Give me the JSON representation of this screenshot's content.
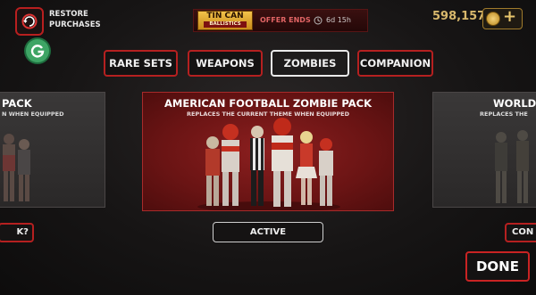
{
  "header": {
    "restore_label": "RESTORE PURCHASES",
    "offer": {
      "logo_line1": "TIN CAN",
      "logo_line2": "BALLISTICS",
      "label": "OFFER ENDS",
      "time": "6d 15h"
    },
    "currency": "598,157"
  },
  "tabs": [
    {
      "label": "RARE SETS",
      "active": false
    },
    {
      "label": "WEAPONS",
      "active": false
    },
    {
      "label": "ZOMBIES",
      "active": true
    },
    {
      "label": "COMPANION",
      "active": false
    }
  ],
  "cards": {
    "left": {
      "title": "PACK",
      "subtitle": "N WHEN EQUIPPED",
      "button": "K?"
    },
    "center": {
      "title": "AMERICAN FOOTBALL ZOMBIE PACK",
      "subtitle": "REPLACES THE CURRENT THEME WHEN EQUIPPED",
      "button": "ACTIVE"
    },
    "right": {
      "title": "WORLD WA",
      "subtitle": "REPLACES THE",
      "button": "CON"
    }
  },
  "footer": {
    "done_label": "DONE"
  },
  "colors": {
    "accent_red": "#b52020",
    "gold": "#d8b86c",
    "card_red": "#7a1818"
  },
  "icons": [
    "restore-icon",
    "g-badge-icon",
    "clock-icon",
    "coin-icon",
    "plus-icon"
  ]
}
